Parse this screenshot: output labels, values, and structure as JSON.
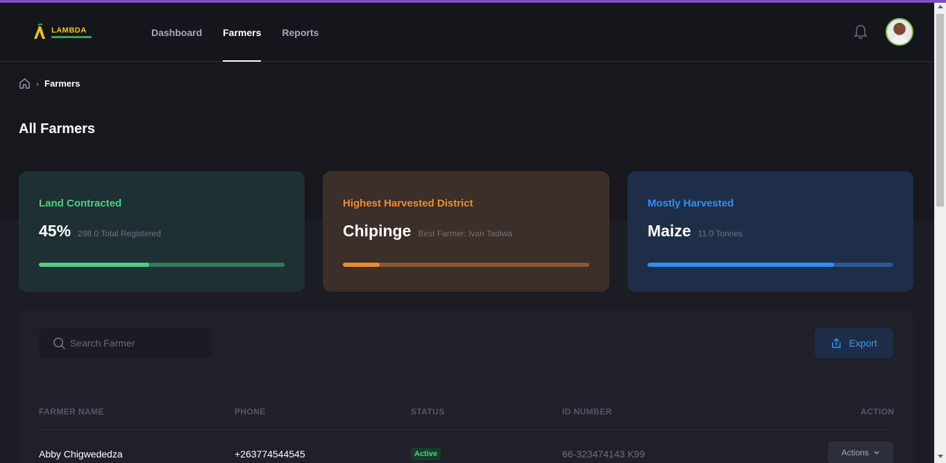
{
  "brand": {
    "name": "LAMBDA"
  },
  "nav": {
    "items": [
      {
        "label": "Dashboard",
        "active": false
      },
      {
        "label": "Farmers",
        "active": true
      },
      {
        "label": "Reports",
        "active": false
      }
    ]
  },
  "breadcrumb": {
    "current": "Farmers"
  },
  "page": {
    "title": "All Farmers"
  },
  "cards": [
    {
      "title": "Land Contracted",
      "value": "45%",
      "sub": "298.0 Total Registered",
      "accent": "#4cd080",
      "track": "#2e7a58",
      "bg": "#1e3034",
      "progress": 0.45
    },
    {
      "title": "Highest Harvested District",
      "value": "Chipinge",
      "sub": "Best Farmer: Ivan Tadiwa",
      "accent": "#f08c2e",
      "track": "#8a5a2e",
      "bg": "#3c2e28",
      "progress": 0.15
    },
    {
      "title": "Mostly Harvested",
      "value": "Maize",
      "sub": "11.0 Tonnes",
      "accent": "#2f8ff5",
      "track": "#2a5a96",
      "bg": "#1f2e48",
      "progress": 0.76
    }
  ],
  "search": {
    "placeholder": "Search Farmer",
    "value": ""
  },
  "export": {
    "label": "Export"
  },
  "table": {
    "headers": [
      "FARMER NAME",
      "PHONE",
      "STATUS",
      "ID NUMBER",
      "ACTION"
    ],
    "rows": [
      {
        "name": "Abby Chigwededza",
        "phone": "+263774544545",
        "status": "Active",
        "id_number": "66-323474143 K99",
        "action": "Actions"
      }
    ]
  },
  "icons": {
    "home": "home-icon",
    "chevron": "chevron-right-icon",
    "bell": "bell-icon",
    "search": "search-icon",
    "export": "upload-icon",
    "dropdown": "chevron-down-icon"
  }
}
